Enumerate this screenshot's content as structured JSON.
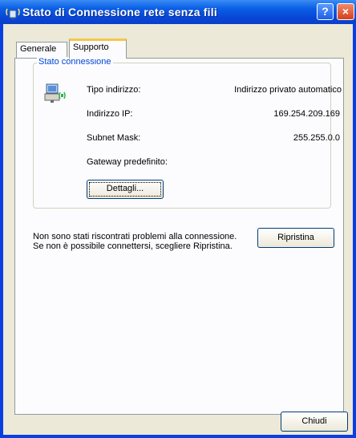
{
  "window": {
    "title": "Stato di Connessione rete senza fili",
    "help_label": "?",
    "close_label": "×"
  },
  "tabs": [
    {
      "label": "Generale",
      "active": false
    },
    {
      "label": "Supporto",
      "active": true
    }
  ],
  "group": {
    "title": "Stato connessione",
    "rows": [
      {
        "label": "Tipo indirizzo:",
        "value": "Indirizzo privato automatico"
      },
      {
        "label": "Indirizzo IP:",
        "value": "169.254.209.169"
      },
      {
        "label": "Subnet Mask:",
        "value": "255.255.0.0"
      },
      {
        "label": "Gateway predefinito:",
        "value": ""
      }
    ],
    "details_button": "Dettagli..."
  },
  "message": "Non sono stati riscontrati problemi alla connessione. Se non è possibile connettersi, scegliere Ripristina.",
  "repair_button": "Ripristina",
  "close_button": "Chiudi",
  "colors": {
    "titlebar": "#0a5fe6",
    "group_title": "#0046d5",
    "tab_highlight": "#f7c64a"
  },
  "icons": {
    "title": "wireless-network-icon",
    "connection": "network-computer-icon"
  }
}
